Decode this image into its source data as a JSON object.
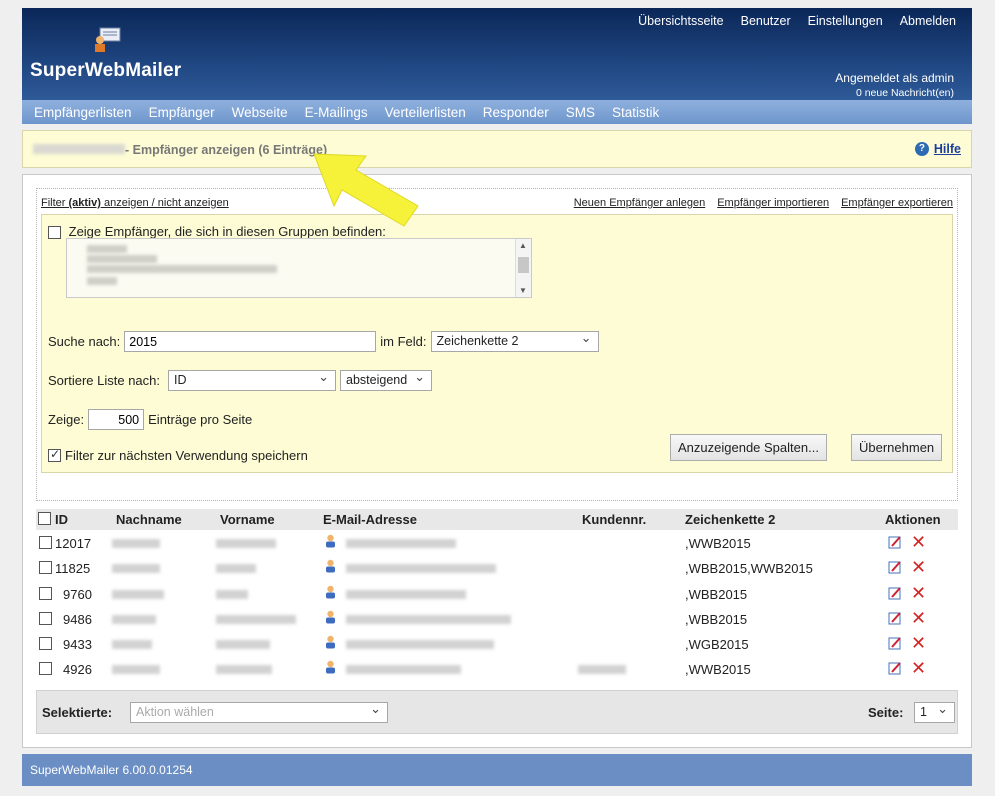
{
  "header": {
    "app_name": "SuperWebMailer",
    "top_links": [
      "Übersichtsseite",
      "Benutzer",
      "Einstellungen",
      "Abmelden"
    ],
    "logged_in": "Angemeldet als admin",
    "messages": "0 neue Nachricht(en)"
  },
  "mainnav": [
    "Empfängerlisten",
    "Empfänger",
    "Webseite",
    "E-Mailings",
    "Verteilerlisten",
    "Responder",
    "SMS",
    "Statistik"
  ],
  "titlebar": {
    "title": "- Empfänger anzeigen (6 Einträge)",
    "help": "Hilfe"
  },
  "filter": {
    "toggle_prefix": "Filter ",
    "toggle_bold": "(aktiv)",
    "toggle_suffix": " anzeigen / nicht anzeigen",
    "actions": [
      "Neuen Empfänger anlegen",
      "Empfänger importieren",
      "Empfänger exportieren"
    ],
    "groups_label": "Zeige Empfänger, die sich in diesen Gruppen befinden:",
    "search_label": "Suche nach:",
    "search_value": "2015",
    "field_label": "im Feld:",
    "field_value": "Zeichenkette 2",
    "sort_label": "Sortiere Liste nach:",
    "sort_value": "ID",
    "sort_dir": "absteigend",
    "show_label": "Zeige:",
    "show_value": "500",
    "show_suffix": "Einträge pro Seite",
    "save_label": "Filter zur nächsten Verwendung speichern",
    "btn_columns": "Anzuzeigende Spalten...",
    "btn_apply": "Übernehmen"
  },
  "table": {
    "headers": [
      "ID",
      "Nachname",
      "Vorname",
      "E-Mail-Adresse",
      "Kundennr.",
      "Zeichenkette 2",
      "Aktionen"
    ],
    "rows": [
      {
        "id": "12017",
        "z2": ",WWB2015"
      },
      {
        "id": "11825",
        "z2": ",WBB2015,WWB2015"
      },
      {
        "id": "9760",
        "z2": ",WBB2015"
      },
      {
        "id": "9486",
        "z2": ",WBB2015"
      },
      {
        "id": "9433",
        "z2": ",WGB2015"
      },
      {
        "id": "4926",
        "z2": ",WWB2015"
      }
    ]
  },
  "bottom": {
    "selected_label": "Selektierte:",
    "action_placeholder": "Aktion wählen",
    "page_label": "Seite:",
    "page_value": "1"
  },
  "footer": {
    "version": "SuperWebMailer 6.00.0.01254"
  },
  "colors": {
    "header_dark": "#0b2758",
    "nav": "#7aa0d3",
    "panel_yellow": "#fdfcd5",
    "arrow": "#f6f23a",
    "delete_red": "#d32525"
  }
}
